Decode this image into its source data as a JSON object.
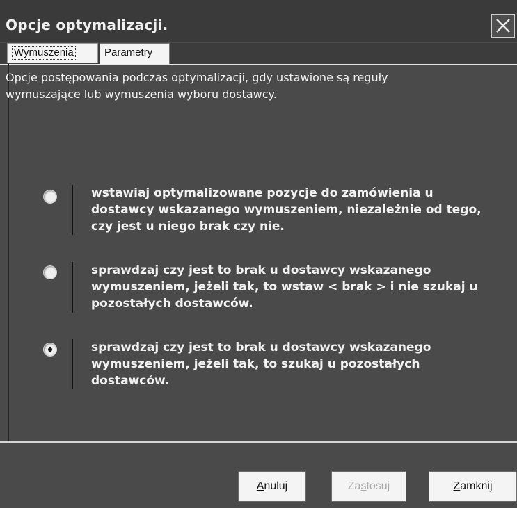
{
  "window": {
    "title": "Opcje optymalizacji."
  },
  "tabs": [
    {
      "label": "Wymuszenia",
      "active": true
    },
    {
      "label": "Parametry",
      "active": false
    }
  ],
  "intro_text": "Opcje postępowania podczas optymalizacji, gdy ustawione są reguły\nwymuszające lub wymuszenia wyboru dostawcy.",
  "options": [
    {
      "text": "wstawiaj optymalizowane pozycje do zamówienia u dostawcy wskazanego wymuszeniem, niezależnie od tego, czy jest u niego brak czy nie.",
      "selected": false
    },
    {
      "text": "sprawdzaj czy jest to brak u dostawcy wskazanego wymuszeniem, jeżeli tak, to wstaw < brak > i nie szukaj u pozostałych dostawców.",
      "selected": false
    },
    {
      "text": "sprawdzaj czy jest to brak u dostawcy wskazanego wymuszeniem, jeżeli tak, to szukaj u pozostałych dostawców.",
      "selected": true
    }
  ],
  "buttons": {
    "cancel": {
      "first": "A",
      "rest": "nuluj"
    },
    "apply": {
      "before": "Za",
      "accel": "s",
      "after": "tosuj",
      "enabled": false
    },
    "close": {
      "first": "Z",
      "rest": "amknij"
    }
  },
  "icons": {
    "close": "close-x-icon"
  }
}
